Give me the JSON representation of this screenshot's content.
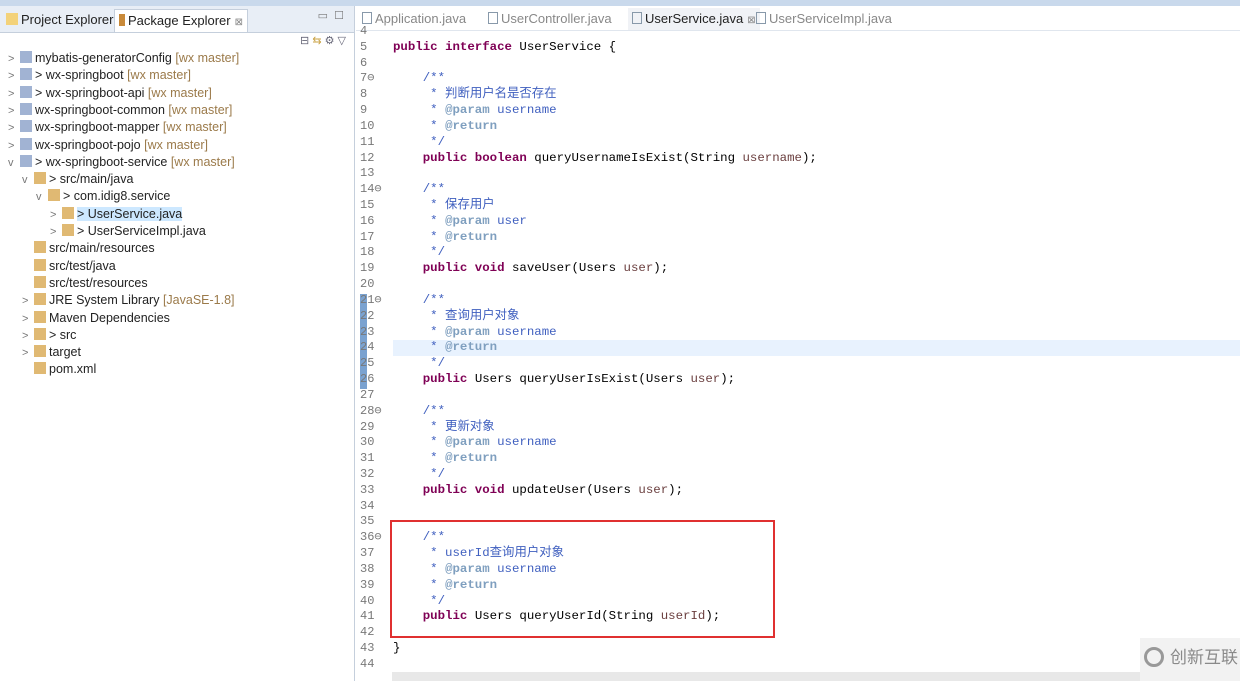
{
  "left_panel": {
    "tabs": [
      {
        "label": "Project Explorer"
      },
      {
        "label": "Package Explorer"
      }
    ],
    "tree": [
      {
        "indent": 0,
        "arrow": ">",
        "label": "mybatis-generatorConfig",
        "dec": "[wx master]"
      },
      {
        "indent": 0,
        "arrow": ">",
        "label": "> wx-springboot",
        "dec": "[wx master]"
      },
      {
        "indent": 0,
        "arrow": ">",
        "label": "> wx-springboot-api",
        "dec": "[wx master]"
      },
      {
        "indent": 0,
        "arrow": ">",
        "label": "wx-springboot-common",
        "dec": "[wx master]"
      },
      {
        "indent": 0,
        "arrow": ">",
        "label": "wx-springboot-mapper",
        "dec": "[wx master]"
      },
      {
        "indent": 0,
        "arrow": ">",
        "label": "wx-springboot-pojo",
        "dec": "[wx master]"
      },
      {
        "indent": 0,
        "arrow": "v",
        "label": "> wx-springboot-service",
        "dec": "[wx master]"
      },
      {
        "indent": 1,
        "arrow": "v",
        "label": "> src/main/java",
        "dec": ""
      },
      {
        "indent": 2,
        "arrow": "v",
        "label": "> com.idig8.service",
        "dec": ""
      },
      {
        "indent": 3,
        "arrow": ">",
        "label": "> UserService.java",
        "dec": "",
        "selected": true
      },
      {
        "indent": 3,
        "arrow": ">",
        "label": "> UserServiceImpl.java",
        "dec": ""
      },
      {
        "indent": 1,
        "arrow": "",
        "label": "src/main/resources",
        "dec": ""
      },
      {
        "indent": 1,
        "arrow": "",
        "label": "src/test/java",
        "dec": ""
      },
      {
        "indent": 1,
        "arrow": "",
        "label": "src/test/resources",
        "dec": ""
      },
      {
        "indent": 1,
        "arrow": ">",
        "label": "JRE System Library",
        "dec": "[JavaSE-1.8]"
      },
      {
        "indent": 1,
        "arrow": ">",
        "label": "Maven Dependencies",
        "dec": ""
      },
      {
        "indent": 1,
        "arrow": ">",
        "label": "> src",
        "dec": ""
      },
      {
        "indent": 1,
        "arrow": ">",
        "label": "target",
        "dec": ""
      },
      {
        "indent": 1,
        "arrow": "",
        "label": "pom.xml",
        "dec": ""
      }
    ]
  },
  "editor": {
    "tabs": [
      {
        "label": "Application.java"
      },
      {
        "label": "UserController.java"
      },
      {
        "label": "UserService.java",
        "active": true
      },
      {
        "label": "UserServiceImpl.java"
      }
    ],
    "current_line": 24,
    "lines": [
      {
        "n": "4",
        "t": []
      },
      {
        "n": "5",
        "t": [
          [
            "kw",
            "public "
          ],
          [
            "kw",
            "interface "
          ],
          [
            "pl",
            "UserService {"
          ]
        ]
      },
      {
        "n": "6",
        "t": []
      },
      {
        "n": "7⊖",
        "t": [
          [
            "cm",
            "    /**"
          ]
        ]
      },
      {
        "n": "8",
        "t": [
          [
            "cm",
            "     * 判断用户名是否存在"
          ]
        ]
      },
      {
        "n": "9",
        "t": [
          [
            "cm",
            "     * "
          ],
          [
            "tag",
            "@param"
          ],
          [
            "cm",
            " username"
          ]
        ]
      },
      {
        "n": "10",
        "t": [
          [
            "cm",
            "     * "
          ],
          [
            "tag",
            "@return"
          ]
        ]
      },
      {
        "n": "11",
        "t": [
          [
            "cm",
            "     */"
          ]
        ]
      },
      {
        "n": "12",
        "t": [
          [
            "pl",
            "    "
          ],
          [
            "kw",
            "public boolean "
          ],
          [
            "pl",
            "queryUsernameIsExist(String "
          ],
          [
            "pn",
            "username"
          ],
          [
            "pl",
            ");"
          ]
        ]
      },
      {
        "n": "13",
        "t": []
      },
      {
        "n": "14⊖",
        "t": [
          [
            "cm",
            "    /**"
          ]
        ]
      },
      {
        "n": "15",
        "t": [
          [
            "cm",
            "     * 保存用户"
          ]
        ]
      },
      {
        "n": "16",
        "t": [
          [
            "cm",
            "     * "
          ],
          [
            "tag",
            "@param"
          ],
          [
            "cm",
            " user"
          ]
        ]
      },
      {
        "n": "17",
        "t": [
          [
            "cm",
            "     * "
          ],
          [
            "tag",
            "@return"
          ]
        ]
      },
      {
        "n": "18",
        "t": [
          [
            "cm",
            "     */"
          ]
        ]
      },
      {
        "n": "19",
        "t": [
          [
            "pl",
            "    "
          ],
          [
            "kw",
            "public void "
          ],
          [
            "pl",
            "saveUser(Users "
          ],
          [
            "pn",
            "user"
          ],
          [
            "pl",
            ");"
          ]
        ]
      },
      {
        "n": "20",
        "t": []
      },
      {
        "n": "21⊖",
        "t": [
          [
            "cm",
            "    /**"
          ]
        ]
      },
      {
        "n": "22",
        "t": [
          [
            "cm",
            "     * 查询用户对象"
          ]
        ]
      },
      {
        "n": "23",
        "t": [
          [
            "cm",
            "     * "
          ],
          [
            "tag",
            "@param"
          ],
          [
            "cm",
            " username"
          ]
        ]
      },
      {
        "n": "24",
        "t": [
          [
            "cm",
            "     * "
          ],
          [
            "tag",
            "@return"
          ]
        ]
      },
      {
        "n": "25",
        "t": [
          [
            "cm",
            "     */"
          ]
        ]
      },
      {
        "n": "26",
        "t": [
          [
            "pl",
            "    "
          ],
          [
            "kw",
            "public "
          ],
          [
            "pl",
            "Users queryUserIsExist(Users "
          ],
          [
            "pn",
            "user"
          ],
          [
            "pl",
            ");"
          ]
        ]
      },
      {
        "n": "27",
        "t": []
      },
      {
        "n": "28⊖",
        "t": [
          [
            "cm",
            "    /**"
          ]
        ]
      },
      {
        "n": "29",
        "t": [
          [
            "cm",
            "     * 更新对象"
          ]
        ]
      },
      {
        "n": "30",
        "t": [
          [
            "cm",
            "     * "
          ],
          [
            "tag",
            "@param"
          ],
          [
            "cm",
            " username"
          ]
        ]
      },
      {
        "n": "31",
        "t": [
          [
            "cm",
            "     * "
          ],
          [
            "tag",
            "@return"
          ]
        ]
      },
      {
        "n": "32",
        "t": [
          [
            "cm",
            "     */"
          ]
        ]
      },
      {
        "n": "33",
        "t": [
          [
            "pl",
            "    "
          ],
          [
            "kw",
            "public void "
          ],
          [
            "pl",
            "updateUser(Users "
          ],
          [
            "pn",
            "user"
          ],
          [
            "pl",
            ");"
          ]
        ]
      },
      {
        "n": "34",
        "t": []
      },
      {
        "n": "35",
        "t": []
      },
      {
        "n": "36⊖",
        "t": [
          [
            "cm",
            "    /**"
          ]
        ]
      },
      {
        "n": "37",
        "t": [
          [
            "cm",
            "     * userId查询用户对象"
          ]
        ]
      },
      {
        "n": "38",
        "t": [
          [
            "cm",
            "     * "
          ],
          [
            "tag",
            "@param"
          ],
          [
            "cm",
            " username"
          ]
        ]
      },
      {
        "n": "39",
        "t": [
          [
            "cm",
            "     * "
          ],
          [
            "tag",
            "@return"
          ]
        ]
      },
      {
        "n": "40",
        "t": [
          [
            "cm",
            "     */"
          ]
        ]
      },
      {
        "n": "41",
        "t": [
          [
            "pl",
            "    "
          ],
          [
            "kw",
            "public "
          ],
          [
            "pl",
            "Users queryUserId(String "
          ],
          [
            "pn",
            "userId"
          ],
          [
            "pl",
            ");"
          ]
        ]
      },
      {
        "n": "42",
        "t": []
      },
      {
        "n": "43",
        "t": [
          [
            "pl",
            "}"
          ]
        ]
      },
      {
        "n": "44",
        "t": []
      }
    ]
  },
  "watermark": {
    "text": "创新互联"
  }
}
